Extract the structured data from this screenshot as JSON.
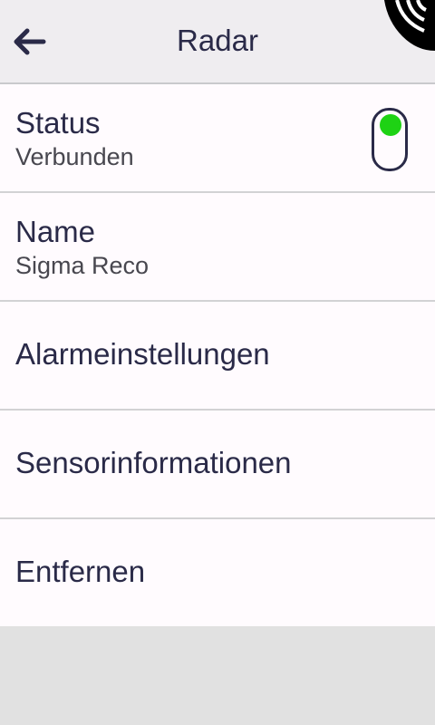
{
  "header": {
    "title": "Radar",
    "back_icon": "arrow-left-icon"
  },
  "rows": [
    {
      "title": "Status",
      "subtitle": "Verbunden",
      "toggle_on": true
    },
    {
      "title": "Name",
      "subtitle": "Sigma Reco"
    },
    {
      "title": "Alarmeinstellungen"
    },
    {
      "title": "Sensorinformationen"
    },
    {
      "title": "Entfernen"
    }
  ],
  "colors": {
    "text_primary": "#2a2a48",
    "toggle_on": "#1ed214",
    "header_bg": "#efedf0",
    "row_bg": "#fffbfe"
  },
  "icons": {
    "corner": "nfc-signal-icon"
  }
}
